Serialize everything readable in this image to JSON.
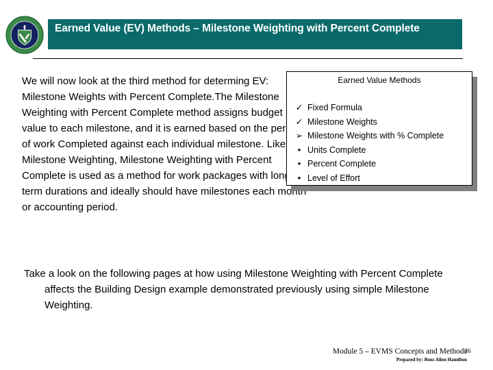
{
  "header": {
    "logo_name": "doe-seal-logo",
    "title": "Earned Value (EV) Methods – Milestone Weighting with Percent Complete",
    "bar_color": "#0a6a6a",
    "title_color": "#ffffff"
  },
  "body": {
    "intro_paragraph": "We will now look at the third method for determing EV: Milestone Weights with Percent Complete.The Milestone Weighting with Percent Complete method assigns budget value to each milestone, and it is earned based on the percent of work Completed against each individual milestone. Like Milestone Weighting, Milestone Weighting with Percent Complete is used as a method for work packages with long term durations and ideally should have milestones each month or accounting period.",
    "closing_paragraph": "Take a look on the following pages at how using Milestone Weighting with Percent Complete affects the Building Design example demonstrated previously using simple Milestone Weighting."
  },
  "methods_box": {
    "title": "Earned Value Methods",
    "shadow_color": "#808080",
    "border_color": "#000000",
    "items": [
      {
        "marker": "✓",
        "marker_name": "check-icon",
        "label": "Fixed Formula"
      },
      {
        "marker": "✓",
        "marker_name": "check-icon",
        "label": "Milestone Weights"
      },
      {
        "marker": "➢",
        "marker_name": "arrow-icon",
        "label": "Milestone Weights with % Complete"
      },
      {
        "marker": "•",
        "marker_name": "bullet-icon",
        "label": "Units Complete"
      },
      {
        "marker": "•",
        "marker_name": "bullet-icon",
        "label": "Percent Complete"
      },
      {
        "marker": "•",
        "marker_name": "bullet-icon",
        "label": "Level of Effort"
      }
    ]
  },
  "footer": {
    "module": "Module 5 – EVMS Concepts and Methods",
    "page_number": "36",
    "prepared_by": "Prepared by: Booz Allen Hamilton"
  }
}
